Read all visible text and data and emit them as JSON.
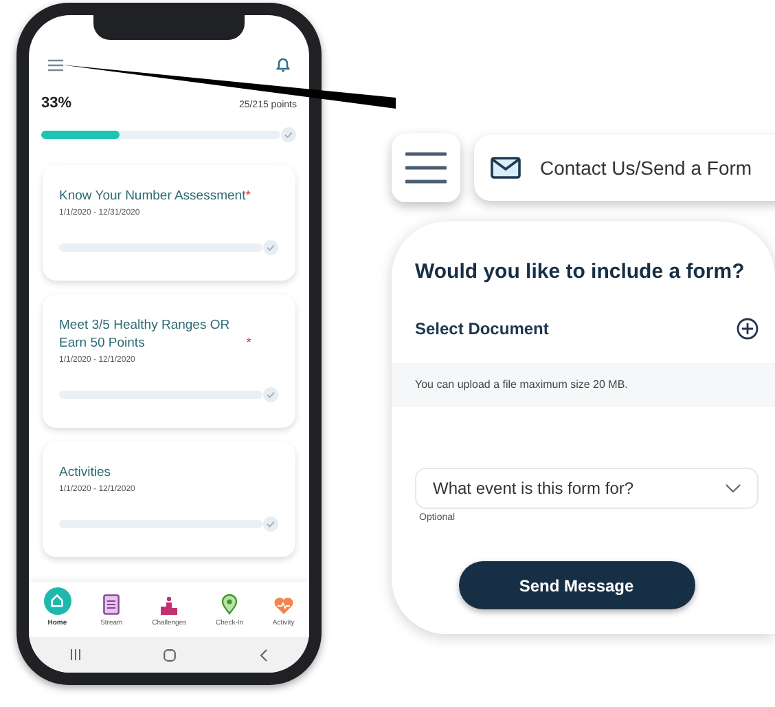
{
  "phone": {
    "progress": {
      "percent": "33%",
      "points": "25/215 points",
      "level": 0.33
    },
    "cards": [
      {
        "title": "Know Your Number Assessment",
        "required_mark": "*",
        "dates": "1/1/2020 - 12/31/2020"
      },
      {
        "title": "Meet 3/5 Healthy Ranges OR Earn 50 Points",
        "required_mark": "*",
        "dates": "1/1/2020 - 12/1/2020"
      },
      {
        "title": "Activities",
        "dates": "1/1/2020 - 12/1/2020"
      }
    ],
    "nav": [
      {
        "label": "Home",
        "kind": "home",
        "selected": true
      },
      {
        "label": "Stream",
        "kind": "stream",
        "selected": false
      },
      {
        "label": "Challenges",
        "kind": "challenges",
        "selected": false
      },
      {
        "label": "Check-In",
        "kind": "checkin",
        "selected": false
      },
      {
        "label": "Activity",
        "kind": "activity",
        "selected": false
      }
    ]
  },
  "callout": {
    "title": "Contact Us/Send a Form",
    "heading": "Would you like to include a form?",
    "select_document": "Select Document",
    "upload_note": "You can upload a file maximum size 20 MB.",
    "event_select": {
      "placeholder": "What event is this form for?",
      "hint": "Optional"
    },
    "button": "Send Message"
  }
}
